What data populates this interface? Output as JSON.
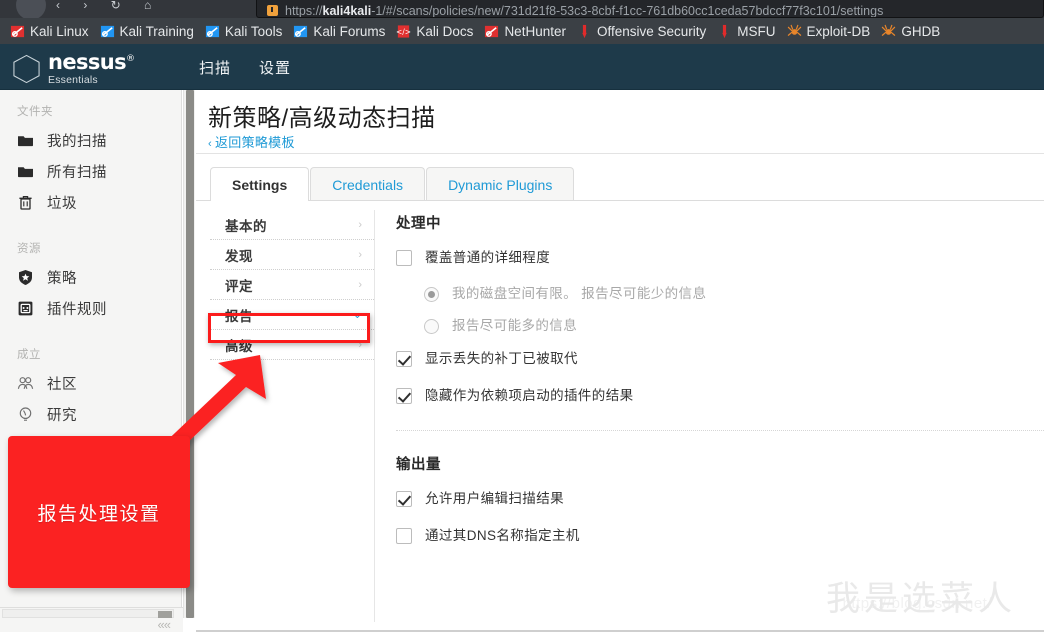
{
  "browser": {
    "url_prefix": "https://",
    "url_host": "kali4kali",
    "url_rest": "-1/#/scans/policies/new/731d21f8-53c3-8cbf-f1cc-761db60cc1ceda57bdccf77f3c101/settings",
    "nav_icons": "‹ › ↻ ⌂",
    "bookmarks": [
      {
        "label": "Kali Linux",
        "icon": "kali-dragon-icon"
      },
      {
        "label": "Kali Training",
        "icon": "kali-dragon-blue-icon"
      },
      {
        "label": "Kali Tools",
        "icon": "kali-dragon-blue-icon"
      },
      {
        "label": "Kali Forums",
        "icon": "kali-dragon-blue-icon"
      },
      {
        "label": "Kali Docs",
        "icon": "kali-docs-book-icon"
      },
      {
        "label": "NetHunter",
        "icon": "kali-dragon-icon"
      },
      {
        "label": "Offensive Security",
        "icon": "offsec-icon"
      },
      {
        "label": "MSFU",
        "icon": "offsec-icon"
      },
      {
        "label": "Exploit-DB",
        "icon": "exploit-db-spider-icon"
      },
      {
        "label": "GHDB",
        "icon": "exploit-db-spider-icon"
      }
    ]
  },
  "app_header": {
    "brand": "nessus",
    "brand_tm": "®",
    "edition": "Essentials",
    "nav": [
      {
        "label": "扫描"
      },
      {
        "label": "设置"
      }
    ]
  },
  "sidebar": {
    "groups": [
      {
        "title": "文件夹",
        "items": [
          {
            "label": "我的扫描",
            "icon": "folder-icon"
          },
          {
            "label": "所有扫描",
            "icon": "folder-icon"
          },
          {
            "label": "垃圾",
            "icon": "trash-icon"
          }
        ]
      },
      {
        "title": "资源",
        "items": [
          {
            "label": "策略",
            "icon": "shield-star-icon"
          },
          {
            "label": "插件规则",
            "icon": "plugin-rules-icon"
          }
        ]
      },
      {
        "title": "成立",
        "items": [
          {
            "label": "社区",
            "icon": "community-people-icon"
          },
          {
            "label": "研究",
            "icon": "research-bulb-icon"
          }
        ]
      }
    ],
    "collapse_label": "««"
  },
  "main": {
    "title": "新策略/高级动态扫描",
    "back_link": "返回策略模板",
    "back_chevron": "‹",
    "tabs": [
      {
        "label": "Settings",
        "active": true
      },
      {
        "label": "Credentials",
        "active": false
      },
      {
        "label": "Dynamic Plugins",
        "active": false
      }
    ],
    "settings_nav": [
      {
        "label": "基本的",
        "arrow": "›",
        "open": false
      },
      {
        "label": "发现",
        "arrow": "›",
        "open": false
      },
      {
        "label": "评定",
        "arrow": "›",
        "open": false
      },
      {
        "label": "报告",
        "arrow": "⌄",
        "open": true
      },
      {
        "label": "高级",
        "arrow": "›",
        "open": false
      }
    ],
    "sections": [
      {
        "title": "处理中",
        "options": [
          {
            "type": "checkbox",
            "checked": false,
            "label": "覆盖普通的详细程度"
          },
          {
            "type": "radio",
            "selected": true,
            "label": "我的磁盘空间有限。 报告尽可能少的信息"
          },
          {
            "type": "radio",
            "selected": false,
            "label": "报告尽可能多的信息"
          },
          {
            "type": "checkbox",
            "checked": true,
            "label": "显示丢失的补丁已被取代"
          },
          {
            "type": "checkbox",
            "checked": true,
            "label": "隐藏作为依赖项启动的插件的结果"
          }
        ]
      },
      {
        "title": "输出量",
        "options": [
          {
            "type": "checkbox",
            "checked": true,
            "label": "允许用户编辑扫描结果"
          },
          {
            "type": "checkbox",
            "checked": false,
            "label": "通过其DNS名称指定主机"
          }
        ]
      }
    ]
  },
  "annotations": {
    "callout_text": "报告处理设置",
    "callout_color": "#fb2222",
    "highlight_color": "#fb1b1b"
  },
  "watermark": {
    "text": "我是选菜人",
    "url": "https://blog.csdn.net/"
  }
}
